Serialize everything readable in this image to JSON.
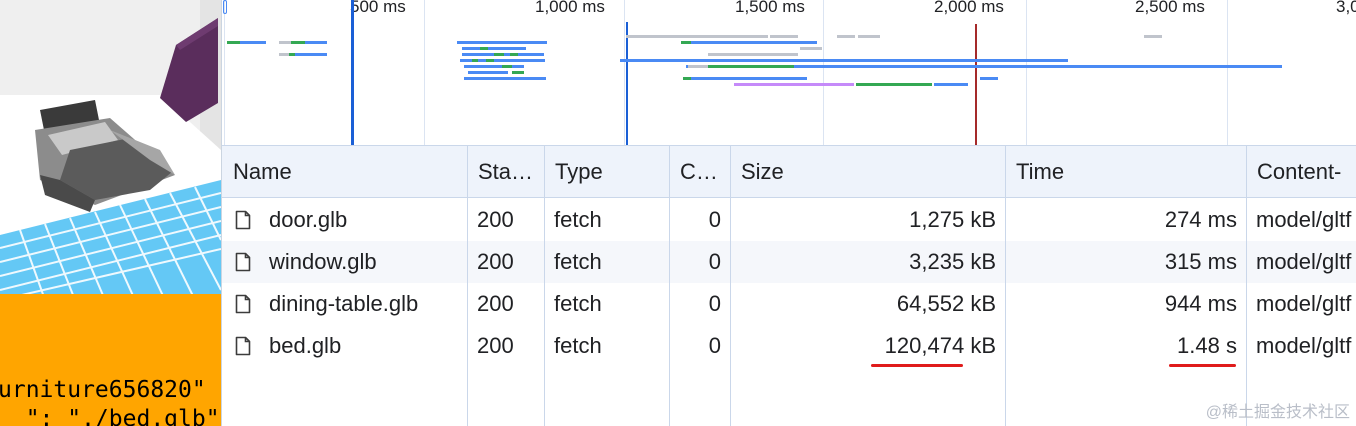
{
  "preview": {
    "code_lines": [
      "urniture656820\"",
      "  \": \"./bed.glb\""
    ]
  },
  "timeline": {
    "ticks": [
      "500 ms",
      "1,000 ms",
      "1,500 ms",
      "2,000 ms",
      "2,500 ms",
      "3,0"
    ]
  },
  "table": {
    "columns": [
      "Name",
      "Status",
      "Type",
      "C…",
      "Size",
      "Time",
      "Content-"
    ],
    "column_display": [
      "Name",
      "Sta…",
      "Type",
      "C…",
      "Size",
      "Time",
      "Content-"
    ],
    "rows": [
      {
        "name": "door.glb",
        "status": "200",
        "type": "fetch",
        "c": "0",
        "size_num": "1,275",
        "size_unit": "kB",
        "time_num": "274",
        "time_unit": "ms",
        "content": "model/gltf"
      },
      {
        "name": "window.glb",
        "status": "200",
        "type": "fetch",
        "c": "0",
        "size_num": "3,235",
        "size_unit": "kB",
        "time_num": "315",
        "time_unit": "ms",
        "content": "model/gltf"
      },
      {
        "name": "dining-table.glb",
        "status": "200",
        "type": "fetch",
        "c": "0",
        "size_num": "64,552",
        "size_unit": "kB",
        "time_num": "944",
        "time_unit": "ms",
        "content": "model/gltf"
      },
      {
        "name": "bed.glb",
        "status": "200",
        "type": "fetch",
        "c": "0",
        "size_num": "120,474",
        "size_unit": "kB",
        "time_num": "1.48",
        "time_unit": "s",
        "content": "model/gltf"
      }
    ],
    "highlighted_row": "bed.glb"
  },
  "watermark": "@稀土掘金技术社区",
  "colors": {
    "waterfall_blue": "#4a8af4",
    "waterfall_green": "#34a853",
    "waterfall_gray": "#c0c4cc",
    "waterfall_purple": "#c58af9",
    "dom_marker": "#1a5fd6",
    "load_marker": "#a52a2a",
    "annotation_red": "#e01b1b",
    "header_bg": "#eef3fb",
    "code_bg": "#ffa500"
  }
}
